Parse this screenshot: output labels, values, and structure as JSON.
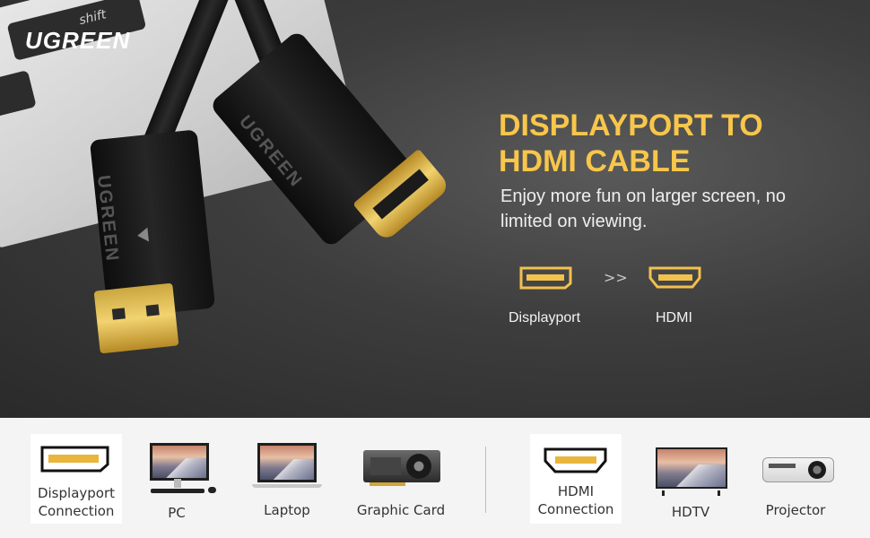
{
  "brand": "UGREEN",
  "keyboard": {
    "shift_label": "shift"
  },
  "connector_logo": "UGREEN",
  "headline": {
    "line1": "DISPLAYPORT TO",
    "line2": "HDMI CABLE"
  },
  "subline": "Enjoy more fun on larger screen, no limited on viewing.",
  "conversion": {
    "from_label": "Displayport",
    "to_label": "HDMI",
    "arrow": ">>"
  },
  "compatibility": {
    "left_group": [
      {
        "label": "Displayport\nConnection",
        "icon": "displayport-port-icon"
      },
      {
        "label": "PC",
        "icon": "desktop-pc-icon"
      },
      {
        "label": "Laptop",
        "icon": "laptop-icon"
      },
      {
        "label": "Graphic Card",
        "icon": "graphics-card-icon"
      }
    ],
    "right_group": [
      {
        "label": "HDMI\nConnection",
        "icon": "hdmi-port-icon"
      },
      {
        "label": "HDTV",
        "icon": "hdtv-icon"
      },
      {
        "label": "Projector",
        "icon": "projector-icon"
      }
    ]
  },
  "colors": {
    "accent": "#f8c64a",
    "hero_bg": "#3d3d3d",
    "strip_bg": "#f4f4f4",
    "gold": "#f2d36f"
  }
}
